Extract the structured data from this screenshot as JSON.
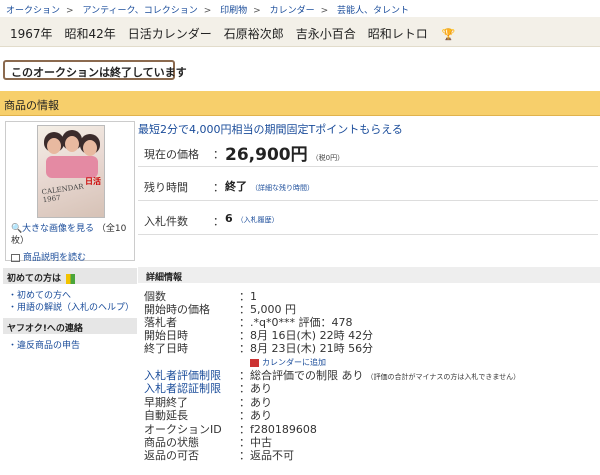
{
  "breadcrumb": [
    "オークション",
    "アンティーク、コレクション",
    "印刷物",
    "カレンダー",
    "芸能人、タレント"
  ],
  "title": {
    "text": "1967年　昭和42年　日活カレンダー　石原裕次郎　吉永小百合　昭和レトロ",
    "icon": "trophy-icon"
  },
  "status": {
    "ended_text": "このオークションは終了しています"
  },
  "section": {
    "header": "商品の情報"
  },
  "item_image": {
    "brand_text": "日活",
    "calendar_text": "CALENDAR 1967",
    "zoom_link": "大きな画像を見る",
    "zoom_count": "（全10枚）",
    "description_link": "商品説明を読む"
  },
  "promo": {
    "text": "最短2分で4,000円相当の期間固定Tポイントもらえる"
  },
  "price": {
    "current_label": "現在の価格",
    "current_value": "26,900円",
    "current_tax": "（税0円）",
    "remaining_label": "残り時間",
    "remaining_value": "終了",
    "remaining_link": "（詳細な残り時間）",
    "bids_label": "入札件数",
    "bids_value": "6",
    "bids_link": "（入札履歴）",
    "colon": "："
  },
  "sidebar": {
    "beginner_header": "初めての方は",
    "beginner_items": [
      "初めての方へ",
      "用語の解説（入札のヘルプ）"
    ],
    "contact_header": "ヤフオク!への連絡",
    "contact_items": [
      "違反商品の申告"
    ]
  },
  "details": {
    "header": "詳細情報",
    "colon": "：",
    "rows": [
      {
        "label": "個数",
        "value": "1"
      },
      {
        "label": "開始時の価格",
        "value": "5,000 円"
      },
      {
        "label": "落札者",
        "value": ".*q*0*** 評価：478"
      },
      {
        "label": "開始日時",
        "value": "8月 16日(木) 22時 42分"
      },
      {
        "label": "終了日時",
        "value": "8月 23日(木) 21時 56分"
      },
      {
        "label": "入札者評価制限",
        "value": "総合評価での制限 あり",
        "note": "（評価の合計がマイナスの方は入札できません）",
        "link": true
      },
      {
        "label": "入札者認証制限",
        "value": "あり",
        "link": true
      },
      {
        "label": "早期終了",
        "value": "あり"
      },
      {
        "label": "自動延長",
        "value": "あり"
      },
      {
        "label": "オークションID",
        "value": "f280189608"
      },
      {
        "label": "商品の状態",
        "value": "中古"
      },
      {
        "label": "返品の可否",
        "value": "返品不可"
      }
    ],
    "calendar_link": "カレンダーに追加"
  },
  "colors": {
    "link": "#1a4c9a",
    "section_header": "#f7cf6b",
    "price_text": "#222222"
  }
}
